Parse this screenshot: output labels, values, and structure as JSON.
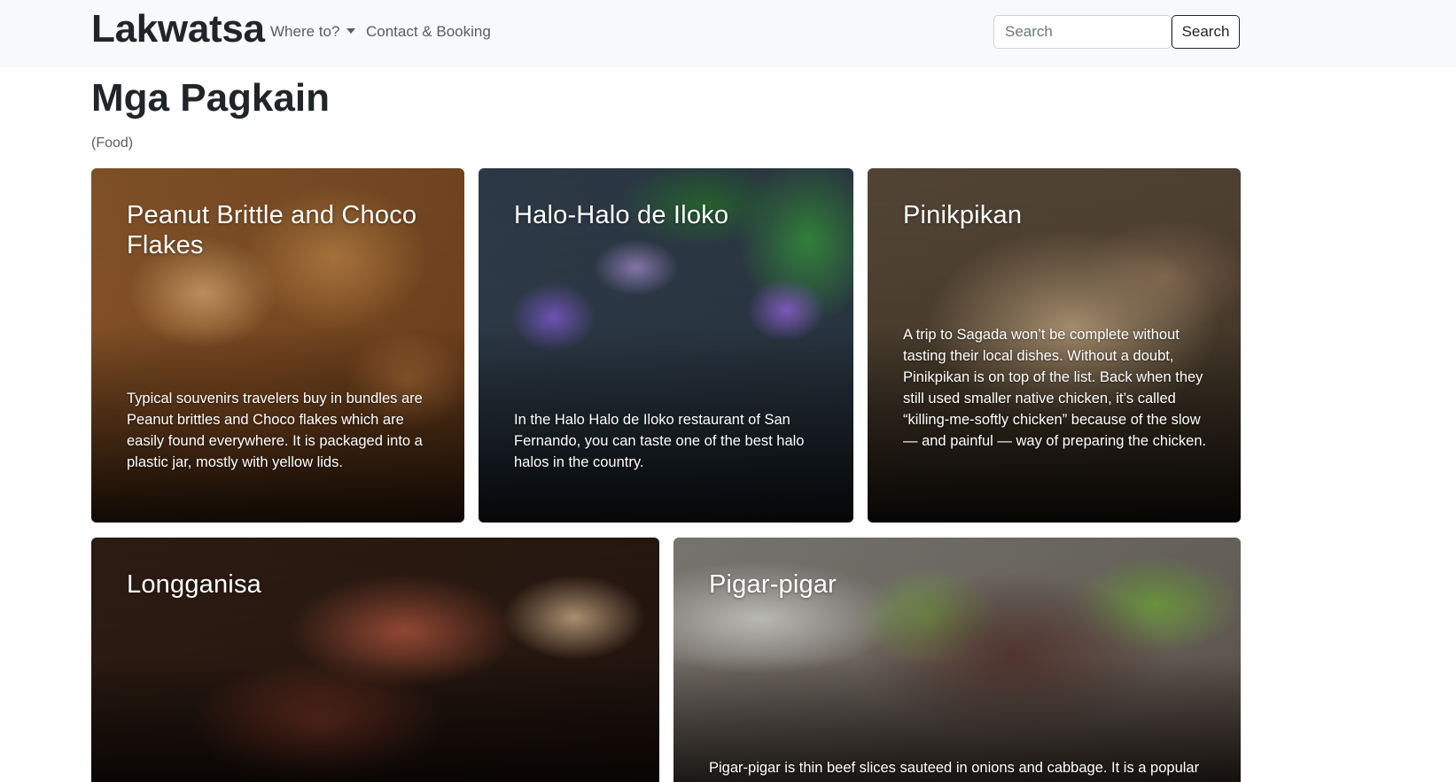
{
  "navbar": {
    "brand": "Lakwatsa",
    "where_to": "Where to?",
    "contact": "Contact & Booking",
    "search_placeholder": "Search",
    "search_button": "Search"
  },
  "page": {
    "title": "Mga Pagkain",
    "subtitle": "(Food)"
  },
  "cards": [
    {
      "title": "Peanut Brittle and Choco Flakes",
      "text": "Typical souvenirs travelers buy in bundles are Peanut brittles and Choco flakes which are easily found everywhere. It is packaged into a plastic jar, mostly with yellow lids."
    },
    {
      "title": "Halo-Halo de Iloko",
      "text": "In the Halo Halo de Iloko restaurant of San Fernando, you can taste one of the best halo halos in the country."
    },
    {
      "title": "Pinikpikan",
      "text": "A trip to Sagada won’t be complete without tasting their local dishes. Without a doubt, Pinikpikan is on top of the list. Back when they still used smaller native chicken, it’s called “killing-me-softly chicken” because of the slow — and painful — way of preparing the chicken."
    },
    {
      "title": "Longganisa",
      "text": ""
    },
    {
      "title": "Pigar-pigar",
      "text": "Pigar-pigar is thin beef slices sauteed in onions and cabbage. It is a popular"
    }
  ]
}
